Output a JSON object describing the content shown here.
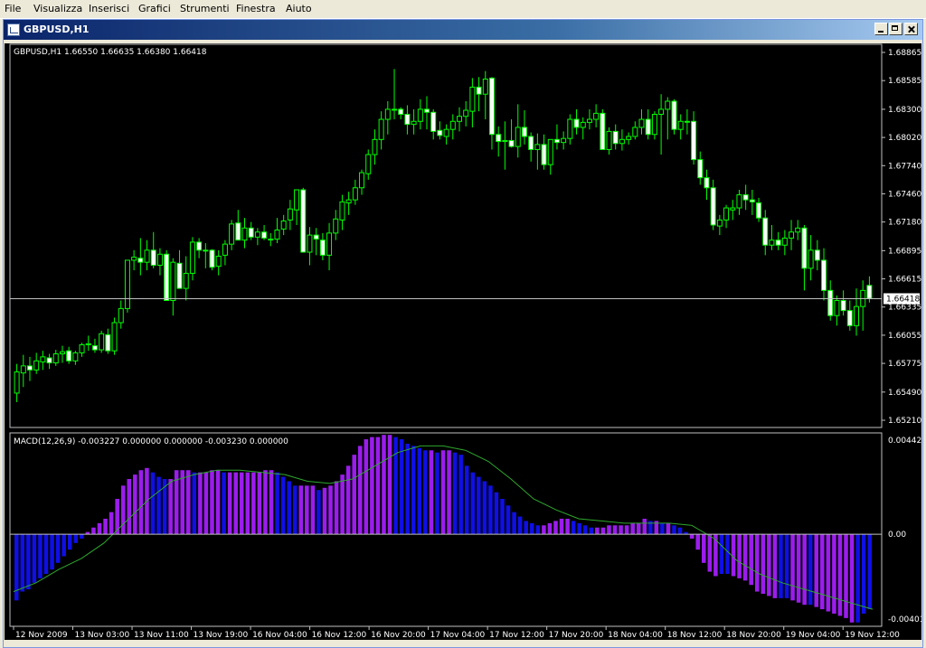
{
  "menu": [
    "File",
    "Visualizza",
    "Inserisci",
    "Grafici",
    "Strumenti",
    "Finestra",
    "Aiuto"
  ],
  "window": {
    "title": "GBPUSD,H1"
  },
  "colors": {
    "bull_wick": "#00ff00",
    "bull_body": "#000000",
    "bear_body": "#ffffff",
    "grid": "#c0c0c0",
    "macd_purple": "#9b1ded",
    "macd_blue": "#0f0fe6",
    "signal": "#2ea82e",
    "background": "#000000"
  },
  "price_chart": {
    "header": "GBPUSD,H1  1.66550 1.66635 1.66380 1.66418",
    "y_ticks": [
      "1.68865",
      "1.68585",
      "1.68300",
      "1.68020",
      "1.67740",
      "1.67460",
      "1.67180",
      "1.66895",
      "1.66615",
      "1.66335",
      "1.66055",
      "1.65775",
      "1.65490",
      "1.65210"
    ],
    "current_price": "1.66418"
  },
  "macd_chart": {
    "header": "MACD(12,26,9) -0.003227 0.000000 0.000000 -0.003230 0.000000",
    "y_ticks": [
      "0.004425",
      "0.00",
      "-0.00401"
    ]
  },
  "x_ticks": [
    "12 Nov 2009",
    "13 Nov 03:00",
    "13 Nov 11:00",
    "13 Nov 19:00",
    "16 Nov 04:00",
    "16 Nov 12:00",
    "16 Nov 20:00",
    "17 Nov 04:00",
    "17 Nov 12:00",
    "17 Nov 20:00",
    "18 Nov 04:00",
    "18 Nov 12:00",
    "18 Nov 20:00",
    "19 Nov 04:00",
    "19 Nov 12:00"
  ],
  "chart_data": [
    {
      "type": "candlestick",
      "title": "GBPUSD,H1",
      "ylim": [
        1.6521,
        1.68865
      ],
      "current": 1.66418,
      "candles": [
        [
          1.6548,
          1.6577,
          1.6539,
          1.6569
        ],
        [
          1.6568,
          1.6586,
          1.6554,
          1.6575
        ],
        [
          1.6575,
          1.6584,
          1.656,
          1.6571
        ],
        [
          1.6571,
          1.6588,
          1.6567,
          1.658
        ],
        [
          1.6579,
          1.659,
          1.6571,
          1.6584
        ],
        [
          1.6583,
          1.6587,
          1.6572,
          1.6578
        ],
        [
          1.6578,
          1.6591,
          1.6575,
          1.6587
        ],
        [
          1.6587,
          1.6595,
          1.6578,
          1.6589
        ],
        [
          1.659,
          1.6594,
          1.6577,
          1.658
        ],
        [
          1.658,
          1.659,
          1.6576,
          1.6588
        ],
        [
          1.6588,
          1.6598,
          1.6584,
          1.6596
        ],
        [
          1.6596,
          1.6605,
          1.659,
          1.6597
        ],
        [
          1.6595,
          1.6602,
          1.6588,
          1.6591
        ],
        [
          1.6591,
          1.661,
          1.6588,
          1.6607
        ],
        [
          1.6606,
          1.6612,
          1.6587,
          1.659
        ],
        [
          1.659,
          1.6623,
          1.6586,
          1.6618
        ],
        [
          1.6618,
          1.664,
          1.6612,
          1.6632
        ],
        [
          1.6632,
          1.667,
          1.6628,
          1.668
        ],
        [
          1.668,
          1.669,
          1.667,
          1.6683
        ],
        [
          1.6682,
          1.6702,
          1.6665,
          1.6678
        ],
        [
          1.6678,
          1.67,
          1.667,
          1.669
        ],
        [
          1.669,
          1.6708,
          1.6672,
          1.6675
        ],
        [
          1.6675,
          1.6692,
          1.6665,
          1.6686
        ],
        [
          1.6686,
          1.669,
          1.664,
          1.664
        ],
        [
          1.664,
          1.6682,
          1.6625,
          1.6678
        ],
        [
          1.6677,
          1.669,
          1.667,
          1.6652
        ],
        [
          1.6652,
          1.6684,
          1.664,
          1.6667
        ],
        [
          1.6667,
          1.6703,
          1.666,
          1.6698
        ],
        [
          1.6698,
          1.6702,
          1.6682,
          1.669
        ],
        [
          1.669,
          1.6697,
          1.6672,
          1.669
        ],
        [
          1.669,
          1.6691,
          1.667,
          1.6673
        ],
        [
          1.6674,
          1.669,
          1.6665,
          1.6684
        ],
        [
          1.6685,
          1.67,
          1.6675,
          1.6696
        ],
        [
          1.6696,
          1.672,
          1.669,
          1.6716
        ],
        [
          1.6717,
          1.673,
          1.6705,
          1.67
        ],
        [
          1.67,
          1.6722,
          1.6692,
          1.6712
        ],
        [
          1.6712,
          1.6718,
          1.67,
          1.6703
        ],
        [
          1.6703,
          1.6712,
          1.6695,
          1.6708
        ],
        [
          1.6708,
          1.6715,
          1.67,
          1.6702
        ],
        [
          1.6701,
          1.6707,
          1.6694,
          1.6701
        ],
        [
          1.6701,
          1.6722,
          1.6697,
          1.671
        ],
        [
          1.6711,
          1.6725,
          1.6705,
          1.6719
        ],
        [
          1.672,
          1.674,
          1.671,
          1.6731
        ],
        [
          1.673,
          1.6745,
          1.6715,
          1.675
        ],
        [
          1.675,
          1.6752,
          1.67,
          1.6688
        ],
        [
          1.6688,
          1.6713,
          1.6675,
          1.6705
        ],
        [
          1.6705,
          1.6712,
          1.6685,
          1.6701
        ],
        [
          1.67,
          1.6707,
          1.668,
          1.6685
        ],
        [
          1.6685,
          1.6717,
          1.667,
          1.6707
        ],
        [
          1.6707,
          1.673,
          1.67,
          1.6721
        ],
        [
          1.672,
          1.6745,
          1.671,
          1.6738
        ],
        [
          1.6737,
          1.6748,
          1.6725,
          1.674
        ],
        [
          1.674,
          1.676,
          1.6735,
          1.6752
        ],
        [
          1.6752,
          1.677,
          1.6745,
          1.6767
        ],
        [
          1.6766,
          1.679,
          1.676,
          1.6785
        ],
        [
          1.6785,
          1.681,
          1.6775,
          1.68
        ],
        [
          1.68,
          1.6828,
          1.679,
          1.682
        ],
        [
          1.682,
          1.6838,
          1.6805,
          1.683
        ],
        [
          1.683,
          1.687,
          1.682,
          1.683
        ],
        [
          1.683,
          1.6832,
          1.682,
          1.6825
        ],
        [
          1.6825,
          1.6834,
          1.6805,
          1.6815
        ],
        [
          1.6815,
          1.683,
          1.6805,
          1.6818
        ],
        [
          1.6818,
          1.684,
          1.681,
          1.683
        ],
        [
          1.683,
          1.6843,
          1.681,
          1.6827
        ],
        [
          1.6827,
          1.683,
          1.68,
          1.6808
        ],
        [
          1.6809,
          1.6818,
          1.68,
          1.6804
        ],
        [
          1.6803,
          1.6815,
          1.6795,
          1.681
        ],
        [
          1.681,
          1.6825,
          1.68,
          1.6818
        ],
        [
          1.6818,
          1.6832,
          1.6808,
          1.6823
        ],
        [
          1.6823,
          1.6838,
          1.6813,
          1.6829
        ],
        [
          1.6828,
          1.6861,
          1.6812,
          1.6852
        ],
        [
          1.6852,
          1.6862,
          1.6828,
          1.6845
        ],
        [
          1.6845,
          1.6868,
          1.682,
          1.686
        ],
        [
          1.6861,
          1.6862,
          1.679,
          1.6805
        ],
        [
          1.6805,
          1.6813,
          1.6783,
          1.6798
        ],
        [
          1.6798,
          1.6818,
          1.677,
          1.6799
        ],
        [
          1.6799,
          1.682,
          1.6792,
          1.6793
        ],
        [
          1.6793,
          1.6835,
          1.6782,
          1.6812
        ],
        [
          1.6812,
          1.6829,
          1.6795,
          1.6803
        ],
        [
          1.6803,
          1.6807,
          1.6778,
          1.679
        ],
        [
          1.679,
          1.6806,
          1.677,
          1.6795
        ],
        [
          1.6795,
          1.6805,
          1.677,
          1.6775
        ],
        [
          1.6775,
          1.68,
          1.6765,
          1.68
        ],
        [
          1.68,
          1.6815,
          1.679,
          1.6797
        ],
        [
          1.6797,
          1.6808,
          1.679,
          1.6801
        ],
        [
          1.6801,
          1.6825,
          1.6795,
          1.682
        ],
        [
          1.682,
          1.683,
          1.6805,
          1.6812
        ],
        [
          1.6812,
          1.6822,
          1.68,
          1.6817
        ],
        [
          1.6817,
          1.683,
          1.681,
          1.682
        ],
        [
          1.682,
          1.6835,
          1.6812,
          1.6826
        ],
        [
          1.6826,
          1.683,
          1.679,
          1.679
        ],
        [
          1.679,
          1.6812,
          1.6785,
          1.6808
        ],
        [
          1.6808,
          1.6815,
          1.679,
          1.6796
        ],
        [
          1.6796,
          1.681,
          1.6789,
          1.68
        ],
        [
          1.68,
          1.6807,
          1.6795,
          1.6803
        ],
        [
          1.6803,
          1.6818,
          1.68,
          1.6812
        ],
        [
          1.6812,
          1.683,
          1.6805,
          1.682
        ],
        [
          1.682,
          1.683,
          1.68,
          1.6805
        ],
        [
          1.6805,
          1.6828,
          1.68,
          1.6825
        ],
        [
          1.6825,
          1.6845,
          1.6785,
          1.683
        ],
        [
          1.683,
          1.6842,
          1.68,
          1.6838
        ],
        [
          1.6838,
          1.684,
          1.6805,
          1.681
        ],
        [
          1.681,
          1.6825,
          1.68,
          1.6818
        ],
        [
          1.6818,
          1.683,
          1.6805,
          1.6818
        ],
        [
          1.6818,
          1.6828,
          1.6775,
          1.678
        ],
        [
          1.678,
          1.6788,
          1.6755,
          1.6762
        ],
        [
          1.6762,
          1.677,
          1.674,
          1.6752
        ],
        [
          1.6752,
          1.676,
          1.671,
          1.6715
        ],
        [
          1.6714,
          1.6725,
          1.6705,
          1.672
        ],
        [
          1.672,
          1.6735,
          1.6712,
          1.6732
        ],
        [
          1.673,
          1.674,
          1.672,
          1.6732
        ],
        [
          1.6732,
          1.675,
          1.6725,
          1.6745
        ],
        [
          1.6745,
          1.6755,
          1.673,
          1.674
        ],
        [
          1.674,
          1.675,
          1.6725,
          1.6738
        ],
        [
          1.6737,
          1.6742,
          1.6718,
          1.6722
        ],
        [
          1.6722,
          1.673,
          1.6685,
          1.6695
        ],
        [
          1.6695,
          1.6715,
          1.669,
          1.67
        ],
        [
          1.67,
          1.6708,
          1.669,
          1.6695
        ],
        [
          1.6695,
          1.671,
          1.6685,
          1.6702
        ],
        [
          1.6702,
          1.672,
          1.669,
          1.6708
        ],
        [
          1.6708,
          1.672,
          1.67,
          1.6712
        ],
        [
          1.6712,
          1.6715,
          1.665,
          1.6672
        ],
        [
          1.6672,
          1.6705,
          1.666,
          1.669
        ],
        [
          1.669,
          1.67,
          1.667,
          1.668
        ],
        [
          1.668,
          1.6692,
          1.664,
          1.665
        ],
        [
          1.665,
          1.666,
          1.662,
          1.6625
        ],
        [
          1.6625,
          1.6645,
          1.6615,
          1.664
        ],
        [
          1.664,
          1.665,
          1.6625,
          1.663
        ],
        [
          1.663,
          1.664,
          1.661,
          1.6615
        ],
        [
          1.6615,
          1.6652,
          1.6605,
          1.6634
        ],
        [
          1.6634,
          1.666,
          1.661,
          1.665
        ],
        [
          1.6655,
          1.6664,
          1.6638,
          1.6642
        ]
      ]
    },
    {
      "type": "bar",
      "title": "MACD(12,26,9)",
      "ylim": [
        -0.00401,
        0.004425
      ],
      "histogram": [
        -0.003,
        -0.0026,
        -0.0025,
        -0.0022,
        -0.002,
        -0.0018,
        -0.0016,
        -0.0013,
        -0.001,
        -0.0007,
        -0.0004,
        -0.0002,
        0.0001,
        0.0003,
        0.0005,
        0.0007,
        0.001,
        0.0016,
        0.0022,
        0.0025,
        0.0027,
        0.0029,
        0.003,
        0.0028,
        0.0026,
        0.0025,
        0.0025,
        0.0029,
        0.0029,
        0.0029,
        0.0028,
        0.0028,
        0.0028,
        0.0029,
        0.0029,
        0.0028,
        0.0028,
        0.0028,
        0.0028,
        0.0028,
        0.0028,
        0.0028,
        0.0029,
        0.0029,
        0.0028,
        0.0026,
        0.0024,
        0.0022,
        0.0022,
        0.0022,
        0.0022,
        0.002,
        0.0021,
        0.0022,
        0.0024,
        0.0027,
        0.0031,
        0.0036,
        0.004,
        0.0043,
        0.0044,
        0.0044,
        0.0045,
        0.0045,
        0.0044,
        0.0043,
        0.0041,
        0.004,
        0.0039,
        0.0038,
        0.0038,
        0.0037,
        0.0038,
        0.0038,
        0.0037,
        0.0036,
        0.0031,
        0.0028,
        0.0026,
        0.0024,
        0.0022,
        0.0019,
        0.0016,
        0.0013,
        0.001,
        0.0008,
        0.0006,
        0.0005,
        0.0004,
        0.0004,
        0.0005,
        0.0006,
        0.0007,
        0.0007,
        0.0006,
        0.0005,
        0.0004,
        0.0003,
        0.0003,
        0.0003,
        0.0004,
        0.0004,
        0.0004,
        0.0004,
        0.0005,
        0.0005,
        0.0007,
        0.0006,
        0.0006,
        0.0005,
        0.0005,
        0.0004,
        0.0003,
        0.0001,
        -0.0002,
        -0.0007,
        -0.0013,
        -0.0017,
        -0.0019,
        -0.0018,
        -0.0018,
        -0.0019,
        -0.002,
        -0.0021,
        -0.0023,
        -0.0026,
        -0.0027,
        -0.0028,
        -0.0029,
        -0.0029,
        -0.0029,
        -0.003,
        -0.0031,
        -0.0032,
        -0.0032,
        -0.0033,
        -0.0034,
        -0.0035,
        -0.0036,
        -0.0037,
        -0.0038,
        -0.004,
        -0.004,
        -0.0036,
        -0.0034
      ],
      "signal_every_4": [
        -0.0026,
        -0.0022,
        -0.0016,
        -0.0011,
        -0.0004,
        0.0006,
        0.0016,
        0.0024,
        0.0027,
        0.0029,
        0.0029,
        0.0028,
        0.0027,
        0.0024,
        0.0023,
        0.0025,
        0.0031,
        0.0037,
        0.004,
        0.004,
        0.0038,
        0.0033,
        0.0025,
        0.0016,
        0.0011,
        0.0007,
        0.0006,
        0.0005,
        0.0005,
        0.0005,
        0.0004,
        -0.0002,
        -0.0012,
        -0.0018,
        -0.0022,
        -0.0025,
        -0.0028,
        -0.0031,
        -0.0034
      ]
    }
  ]
}
